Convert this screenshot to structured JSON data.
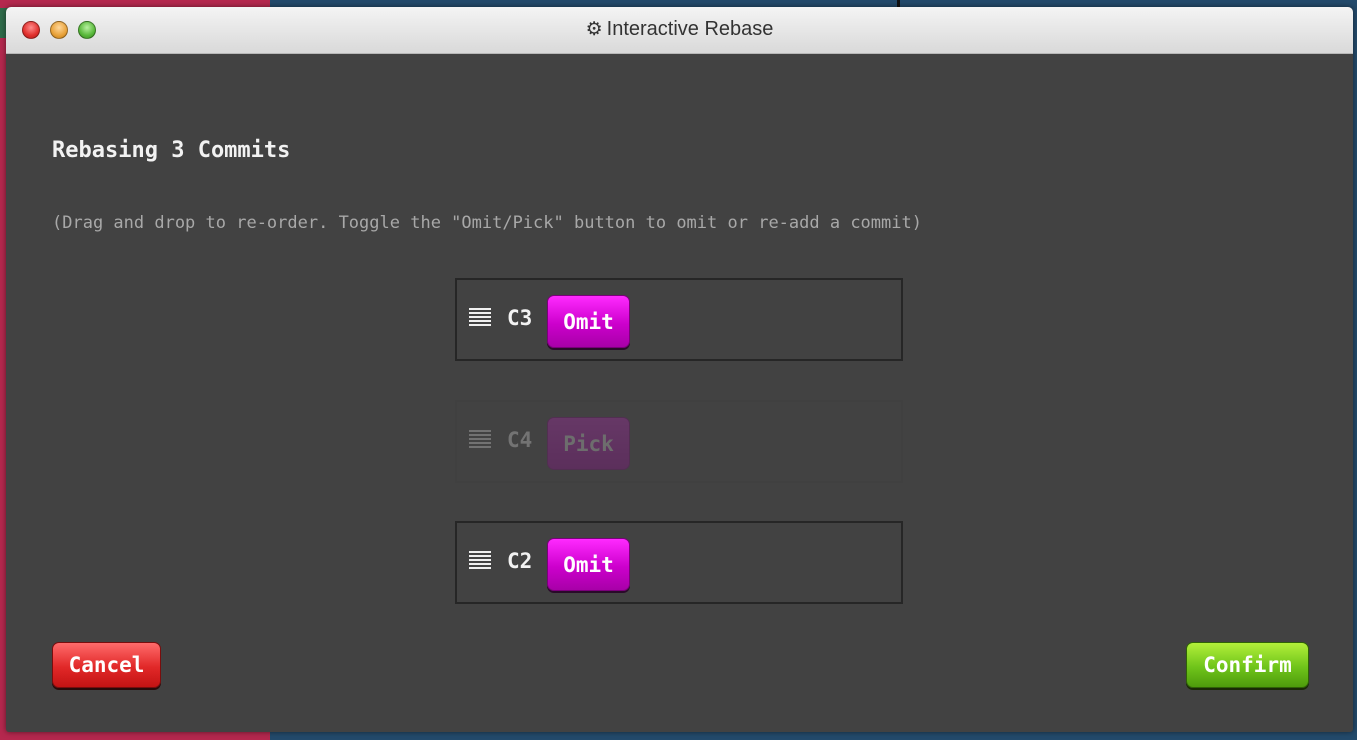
{
  "window": {
    "title": "Interactive Rebase",
    "title_icon": "gear-icon"
  },
  "dialog": {
    "heading": "Rebasing 3 Commits",
    "hint": "(Drag and drop to re-order. Toggle the \"Omit/Pick\" button to omit or re-add a commit)"
  },
  "commits": [
    {
      "id": "C3",
      "toggle_label": "Omit",
      "state": "picked"
    },
    {
      "id": "C4",
      "toggle_label": "Pick",
      "state": "omitted"
    },
    {
      "id": "C2",
      "toggle_label": "Omit",
      "state": "picked"
    }
  ],
  "buttons": {
    "cancel": "Cancel",
    "confirm": "Confirm"
  },
  "colors": {
    "dialog_bg": "#424242",
    "toggle_magenta": "#cc00cc",
    "cancel_red": "#e12828",
    "confirm_green": "#6fc41a"
  }
}
